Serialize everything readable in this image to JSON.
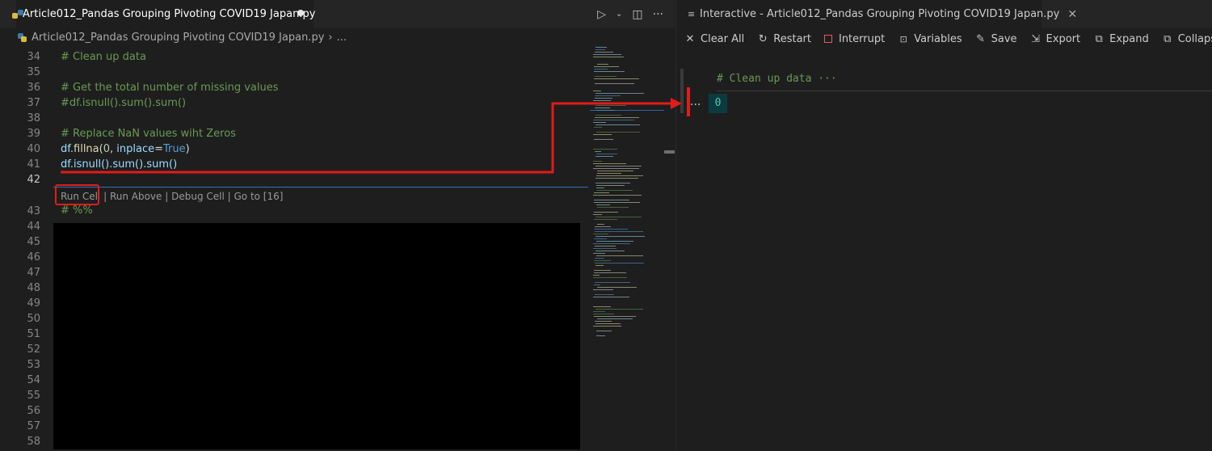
{
  "editor": {
    "tab_title": "Article012_Pandas Grouping Pivoting COVID19 Japan.py",
    "breadcrumb_file": "Article012_Pandas Grouping Pivoting COVID19 Japan.py",
    "breadcrumb_sep": "›",
    "breadcrumb_more": "...",
    "line_numbers": [
      "34",
      "35",
      "36",
      "37",
      "38",
      "39",
      "40",
      "41",
      "42",
      "43",
      "44",
      "45",
      "46",
      "47",
      "48",
      "49",
      "50",
      "51",
      "52",
      "53",
      "54",
      "55",
      "56",
      "57",
      "58"
    ],
    "code": {
      "l34": "# Clean up data",
      "l36": "# Get the total number of missing values",
      "l37": "#df.isnull().sum().sum()",
      "l39": "# Replace NaN values wiht Zeros",
      "l40_df": "df.",
      "l40_fn": "fillna",
      "l40_open": "(",
      "l40_num": "0",
      "l40_mid": ", ",
      "l40_kw": "inplace",
      "l40_eq": "=",
      "l40_true": "True",
      "l40_close": ")",
      "l41": "df.isnull().sum().sum()",
      "l43": "# %%"
    },
    "codelens": {
      "run_cell": "Run Cell",
      "sep1": " | ",
      "run_above": "Run Above",
      "sep2": " | ",
      "debug_cell": "Debug Cell",
      "sep3": " | ",
      "go_to": "Go to [16]"
    }
  },
  "interactive": {
    "tab_title": "Interactive - Article012_Pandas Grouping Pivoting COVID19 Japan.py",
    "toolbar": {
      "clear_all": "Clear All",
      "restart": "Restart",
      "interrupt": "Interrupt",
      "variables": "Variables",
      "save": "Save",
      "export": "Export",
      "expand": "Expand",
      "collapse": "Collapse"
    },
    "cell_code": "# Clean up data ···",
    "output_prompt": "...",
    "output_value": "0"
  },
  "colors": {
    "annotation_red": "#e31b1b",
    "accent_blue": "#3794ff",
    "comment_green": "#6a9955"
  }
}
